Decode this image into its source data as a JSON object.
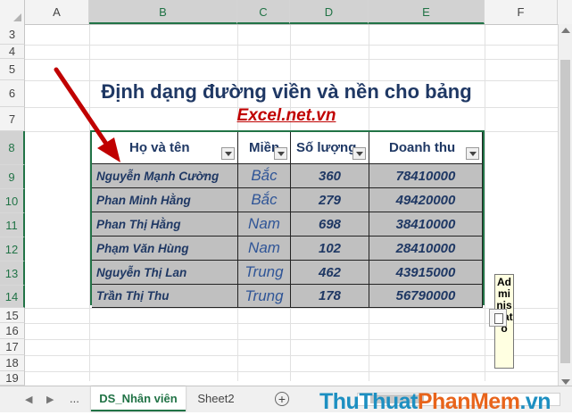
{
  "columns": [
    {
      "label": "A",
      "selected": false
    },
    {
      "label": "B",
      "selected": true
    },
    {
      "label": "C",
      "selected": true
    },
    {
      "label": "D",
      "selected": true
    },
    {
      "label": "E",
      "selected": true
    },
    {
      "label": "F",
      "selected": false
    }
  ],
  "rows": [
    {
      "label": "3",
      "selected": false
    },
    {
      "label": "4",
      "selected": false
    },
    {
      "label": "5",
      "selected": false
    },
    {
      "label": "6",
      "selected": false
    },
    {
      "label": "7",
      "selected": false
    },
    {
      "label": "8",
      "selected": true
    },
    {
      "label": "9",
      "selected": true
    },
    {
      "label": "10",
      "selected": true
    },
    {
      "label": "11",
      "selected": true
    },
    {
      "label": "12",
      "selected": true
    },
    {
      "label": "13",
      "selected": true
    },
    {
      "label": "14",
      "selected": true
    },
    {
      "label": "15",
      "selected": false
    },
    {
      "label": "16",
      "selected": false
    },
    {
      "label": "17",
      "selected": false
    },
    {
      "label": "18",
      "selected": false
    },
    {
      "label": "19",
      "selected": false
    }
  ],
  "title": "Định dạng đường viền và nền cho bảng",
  "subtitle": "Excel.net.vn",
  "table": {
    "headers": [
      "Họ và tên",
      "Miền",
      "Số lượng",
      "Doanh thu"
    ],
    "rows": [
      [
        "Nguyễn  Mạnh Cường",
        "Bắc",
        "360",
        "78410000"
      ],
      [
        "Phan  Minh Hằng",
        "Bắc",
        "279",
        "49420000"
      ],
      [
        "Phan  Thị Hằng",
        "Nam",
        "698",
        "38410000"
      ],
      [
        "Phạm  Văn Hùng",
        "Nam",
        "102",
        "28410000"
      ],
      [
        "Nguyễn  Thị Lan",
        "Trung",
        "462",
        "43915000"
      ],
      [
        "Trần  Thị Thu",
        "Trung",
        "178",
        "56790000"
      ]
    ]
  },
  "comment": {
    "author": "Administrato"
  },
  "tabs": {
    "more": "...",
    "active": "DS_Nhân viên",
    "second": "Sheet2",
    "add_symbol": "+"
  },
  "watermark": {
    "part1": "ThuThuat",
    "part2": "PhanMem",
    "part3": ".vn"
  },
  "colors": {
    "accent": "#217346",
    "title": "#1f3864",
    "subtitle": "#c00000",
    "fill": "#c0c0c0"
  }
}
